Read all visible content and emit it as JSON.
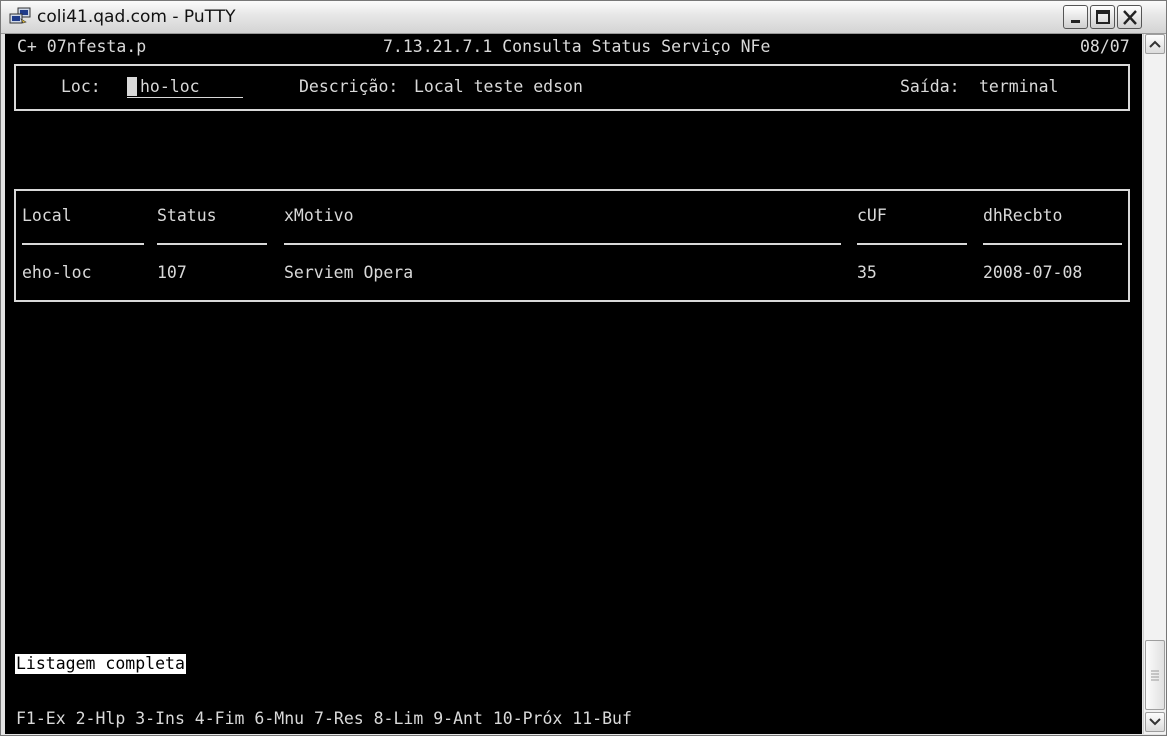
{
  "window": {
    "title": "coli41.qad.com - PuTTY"
  },
  "header": {
    "left": "C+ 07nfesta.p",
    "center": "7.13.21.7.1 Consulta Status Serviço NFe",
    "right": "08/07"
  },
  "form": {
    "loc_label": "Loc:",
    "loc_value": "ho-loc",
    "descricao_label": "Descrição:",
    "descricao_value": "Local teste edson",
    "saida_label": "Saída:",
    "saida_value": "terminal"
  },
  "table": {
    "columns": [
      "Local",
      "Status",
      "xMotivo",
      "cUF",
      "dhRecbto"
    ],
    "rows": [
      [
        "eho-loc",
        "107",
        "Serviem Opera",
        "35",
        "2008-07-08"
      ]
    ]
  },
  "status_message": "Listagem completa",
  "function_keys": "F1-Ex 2-Hlp 3-Ins 4-Fim 6-Mnu 7-Res 8-Lim 9-Ant 10-Próx 11-Buf",
  "icons": {
    "app": "putty-icon",
    "minimize": "minimize-icon",
    "maximize": "maximize-icon",
    "close": "close-icon",
    "scroll_up": "arrow-up-icon",
    "scroll_down": "arrow-down-icon"
  }
}
